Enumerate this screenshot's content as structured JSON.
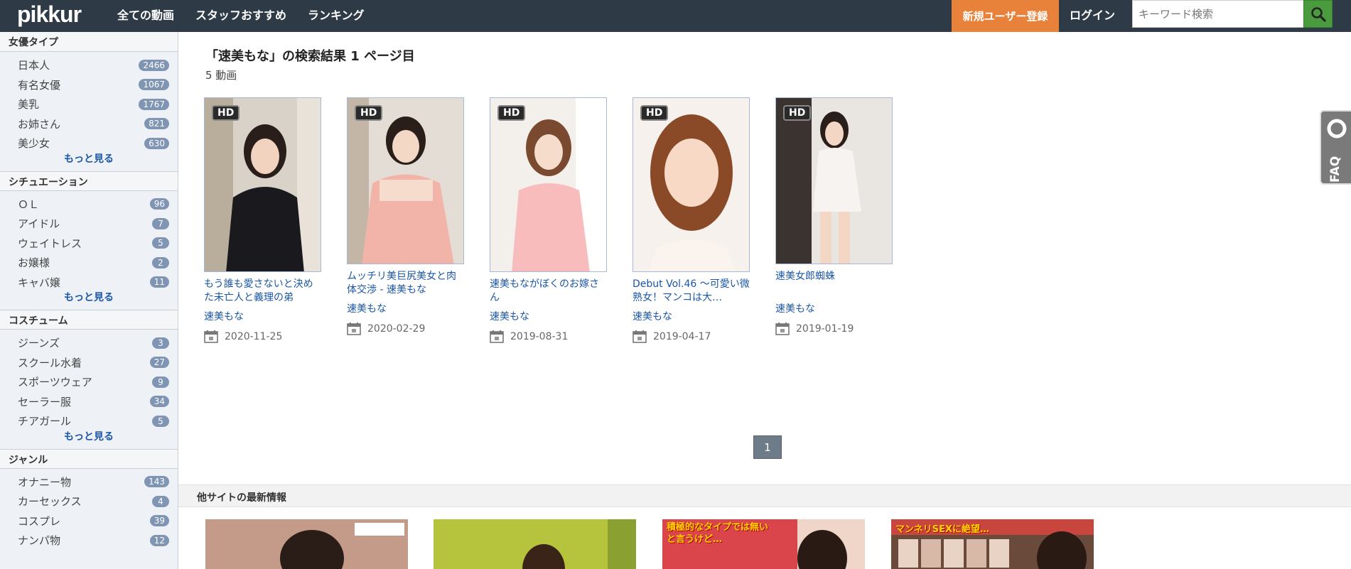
{
  "header": {
    "logo": "pikkur",
    "nav": [
      "全ての動画",
      "スタッフおすすめ",
      "ランキング"
    ],
    "register_label": "新規ユーザー登録",
    "login_label": "ログイン",
    "search_placeholder": "キーワード検索"
  },
  "sidebar": {
    "sections": [
      {
        "title": "女優タイプ",
        "items": [
          {
            "label": "日本人",
            "count": "2466"
          },
          {
            "label": "有名女優",
            "count": "1067"
          },
          {
            "label": "美乳",
            "count": "1767"
          },
          {
            "label": "お姉さん",
            "count": "821"
          },
          {
            "label": "美少女",
            "count": "630"
          }
        ],
        "more": "もっと見る"
      },
      {
        "title": "シチュエーション",
        "items": [
          {
            "label": "ＯＬ",
            "count": "96"
          },
          {
            "label": "アイドル",
            "count": "7"
          },
          {
            "label": "ウェイトレス",
            "count": "5"
          },
          {
            "label": "お嬢様",
            "count": "2"
          },
          {
            "label": "キャバ嬢",
            "count": "11"
          }
        ],
        "more": "もっと見る"
      },
      {
        "title": "コスチューム",
        "items": [
          {
            "label": "ジーンズ",
            "count": "3"
          },
          {
            "label": "スクール水着",
            "count": "27"
          },
          {
            "label": "スポーツウェア",
            "count": "9"
          },
          {
            "label": "セーラー服",
            "count": "34"
          },
          {
            "label": "チアガール",
            "count": "5"
          }
        ],
        "more": "もっと見る"
      },
      {
        "title": "ジャンル",
        "items": [
          {
            "label": "オナニー物",
            "count": "143"
          },
          {
            "label": "カーセックス",
            "count": "4"
          },
          {
            "label": "コスプレ",
            "count": "39"
          },
          {
            "label": "ナンパ物",
            "count": "12"
          }
        ],
        "more": ""
      }
    ]
  },
  "main": {
    "result_title": "「速美もな」の検索結果 1 ページ目",
    "result_count": "5 動画",
    "hd_badge": "HD",
    "videos": [
      {
        "title": "もう誰も愛さないと決めた未亡人と義理の弟",
        "actor": "速美もな",
        "date": "2020-11-25"
      },
      {
        "title": "ムッチリ美巨尻美女と肉体交渉 - 速美もな",
        "actor": "速美もな",
        "date": "2020-02-29"
      },
      {
        "title": "速美もながぼくのお嫁さん",
        "actor": "速美もな",
        "date": "2019-08-31"
      },
      {
        "title": "Debut Vol.46 ～可愛い微熟女！マンコは大…",
        "actor": "速美もな",
        "date": "2019-04-17"
      },
      {
        "title": "速美女郎蜘蛛",
        "actor": "速美もな",
        "date": "2019-01-19"
      }
    ],
    "page": "1",
    "other_sites_title": "他サイトの最新情報",
    "promos": [
      "",
      "",
      "積極的なタイプでは無いと言うけど…",
      "マンネリSEXに絶望…"
    ]
  },
  "faq_label": "FAQ",
  "colors": {
    "header_bg": "#2e3a45",
    "register": "#e8823a",
    "link": "#1a56a8",
    "badge": "#7f95b3"
  }
}
